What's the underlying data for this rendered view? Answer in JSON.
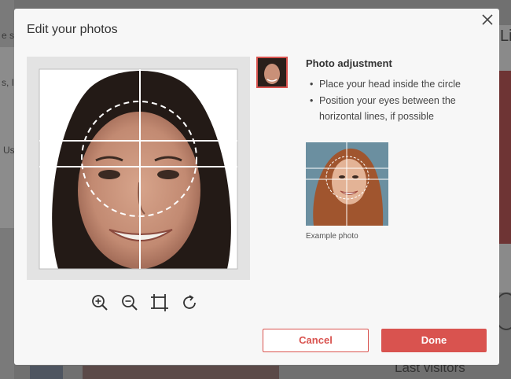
{
  "dialog": {
    "title": "Edit your photos",
    "close_icon": "close-icon"
  },
  "info": {
    "title": "Photo adjustment",
    "bullets": [
      "Place your head inside the circle",
      "Position your eyes between the horizontal lines, if possible"
    ],
    "example_caption": "Example photo"
  },
  "tools": [
    "zoom-in-icon",
    "zoom-out-icon",
    "crop-icon",
    "rotate-icon"
  ],
  "buttons": {
    "cancel": "Cancel",
    "done": "Done"
  },
  "background": {
    "right_title": "Li",
    "bottom_text": "Last visitors",
    "left_fragment_1": "e s",
    "left_fragment_2": "s, Ir",
    "left_fragment_3": "Us"
  },
  "colors": {
    "accent": "#d9534f",
    "dialog_bg": "#f7f7f7",
    "overlay": "#707070"
  }
}
